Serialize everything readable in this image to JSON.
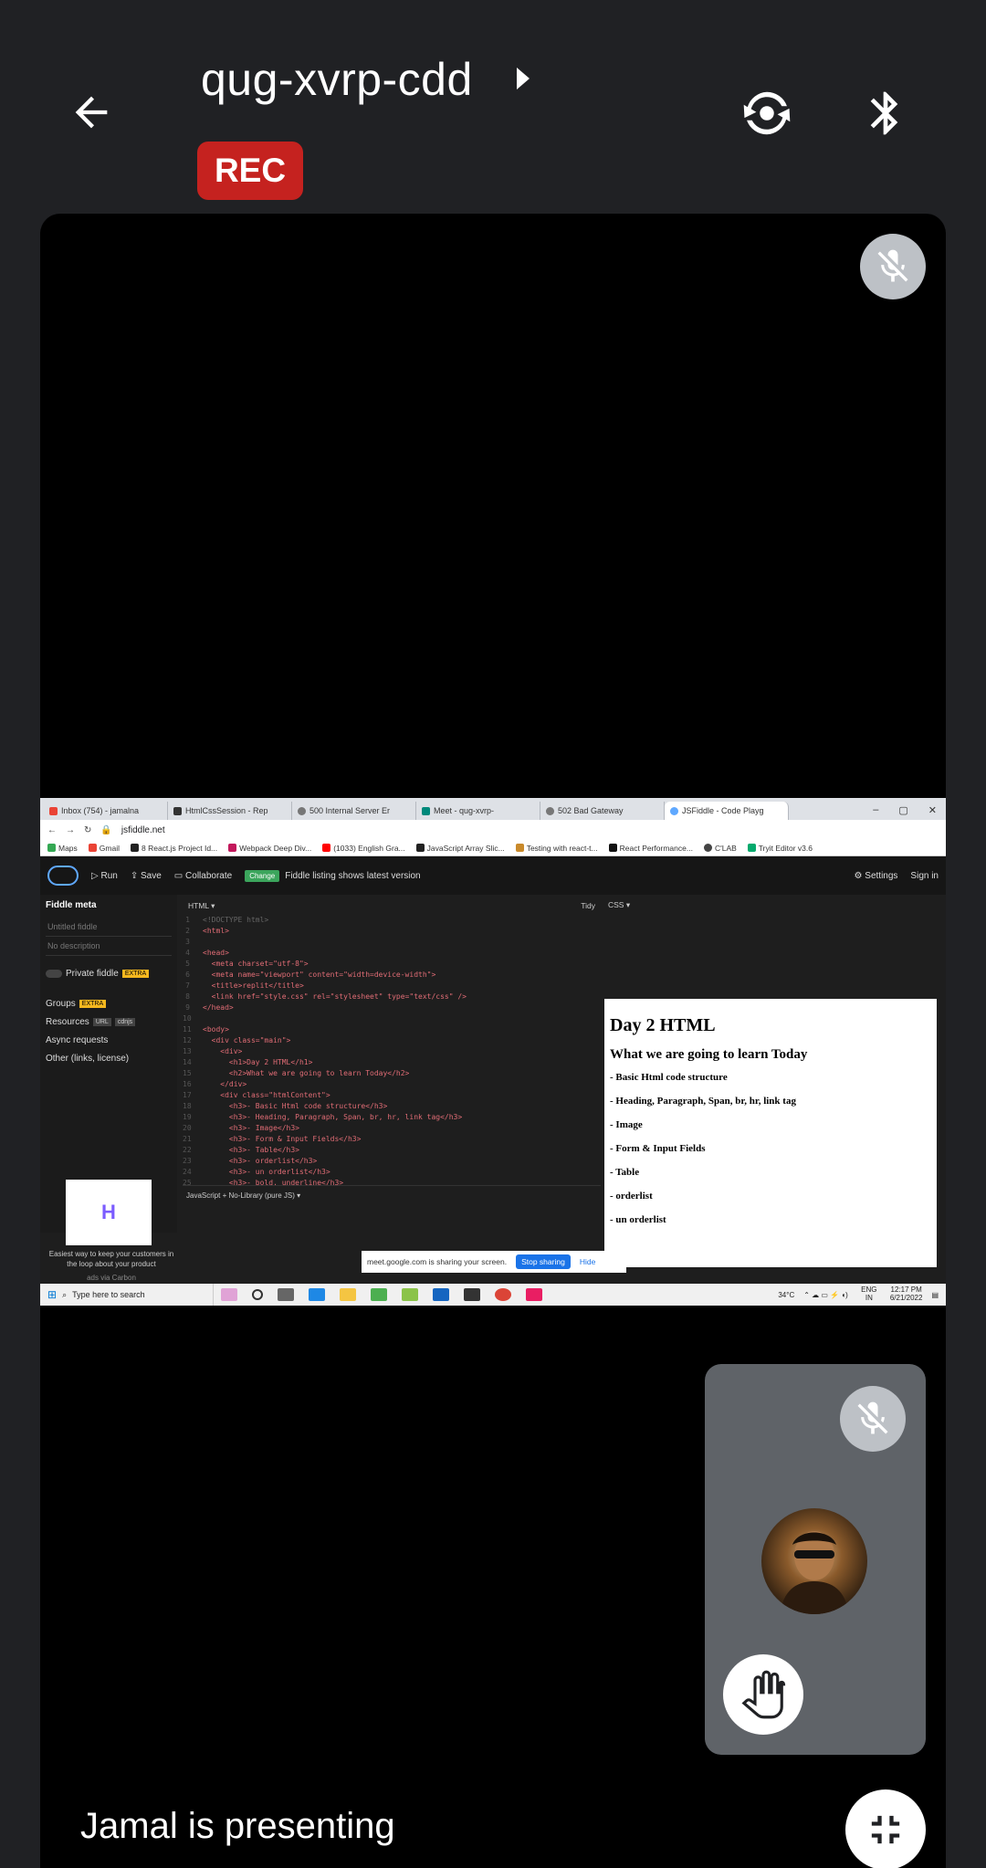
{
  "meeting": {
    "code": "qug-xvrp-cdd",
    "rec_label": "REC",
    "presenting_text": "Jamal is presenting"
  },
  "icons": {
    "back": "arrow-left-icon",
    "caret": "caret-right-icon",
    "switch_camera": "switch-camera-icon",
    "bluetooth": "bluetooth-icon",
    "mic_off": "mic-off-icon",
    "raise_hand": "hand-icon",
    "exit_fullscreen": "exit-fullscreen-icon"
  },
  "colors": {
    "rec": "#c5221f",
    "background": "#202124",
    "tile": "#5f6368"
  },
  "shared_screen": {
    "tabs": [
      "Inbox (754) - jamalna",
      "HtmlCssSession - Rep",
      "500 Internal Server Er",
      "Meet - qug-xvrp-",
      "502 Bad Gateway",
      "JSFiddle - Code Playg"
    ],
    "url": "jsfiddle.net",
    "bookmarks": [
      "Maps",
      "Gmail",
      "8 React.js Project Id...",
      "Webpack Deep Div...",
      "(1033) English Gra...",
      "JavaScript Array Slic...",
      "Testing with react-t...",
      "React Performance...",
      "C'LAB",
      "Tryit Editor v3.6"
    ],
    "jsfiddle": {
      "run": "Run",
      "save": "Save",
      "collaborate": "Collaborate",
      "change_badge": "Change",
      "listing_note": "Fiddle listing shows latest version",
      "settings": "Settings",
      "sign_in": "Sign in",
      "meta_title": "Fiddle meta",
      "untitled": "Untitled fiddle",
      "no_description": "No description",
      "private": "Private fiddle",
      "extra": "EXTRA",
      "groups": "Groups",
      "resources": "Resources",
      "url_badge": "URL",
      "cdnjs_badge": "cdnjs",
      "async": "Async requests",
      "other": "Other (links, license)",
      "ad_text": "Easiest way to keep your customers in the loop about your product",
      "ads_via": "ads via Carbon",
      "html_label": "HTML ▾",
      "tidy": "Tidy",
      "css_label": "CSS ▾",
      "js_label": "JavaScript + No-Library (pure JS) ▾",
      "code_lines": [
        "<!DOCTYPE html>",
        "<html>",
        "",
        "<head>",
        "  <meta charset=\"utf-8\">",
        "  <meta name=\"viewport\" content=\"width=device-width\">",
        "  <title>replit</title>",
        "  <link href=\"style.css\" rel=\"stylesheet\" type=\"text/css\" />",
        "</head>",
        "",
        "<body>",
        "  <div class=\"main\">",
        "    <div>",
        "      <h1>Day 2 HTML</h1>",
        "      <h2>What we are going to learn Today</h2>",
        "    </div>",
        "    <div class=\"htmlContent\">",
        "      <h3>- Basic Html code structure</h3>",
        "      <h3>- Heading, Paragraph, Span, br, hr, link tag</h3>",
        "      <h3>- Image</h3>",
        "      <h3>- Form & Input Fields</h3>",
        "      <h3>- Table</h3>",
        "      <h3>- orderlist</h3>",
        "      <h3>- un orderlist</h3>",
        "      <h3>- bold, underline</h3>"
      ],
      "result": {
        "h1": "Day 2 HTML",
        "h2": "What we are going to learn Today",
        "items": [
          "- Basic Html code structure",
          "- Heading, Paragraph, Span, br, hr, link tag",
          "- Image",
          "- Form & Input Fields",
          "- Table",
          "- orderlist",
          "- un orderlist"
        ]
      }
    },
    "sharing_bar": {
      "text": "meet.google.com is sharing your screen.",
      "stop": "Stop sharing",
      "hide": "Hide"
    },
    "taskbar": {
      "search": "Type here to search",
      "temp": "34°C",
      "lang": "ENG IN",
      "time": "12:17 PM",
      "date": "6/21/2022"
    }
  }
}
